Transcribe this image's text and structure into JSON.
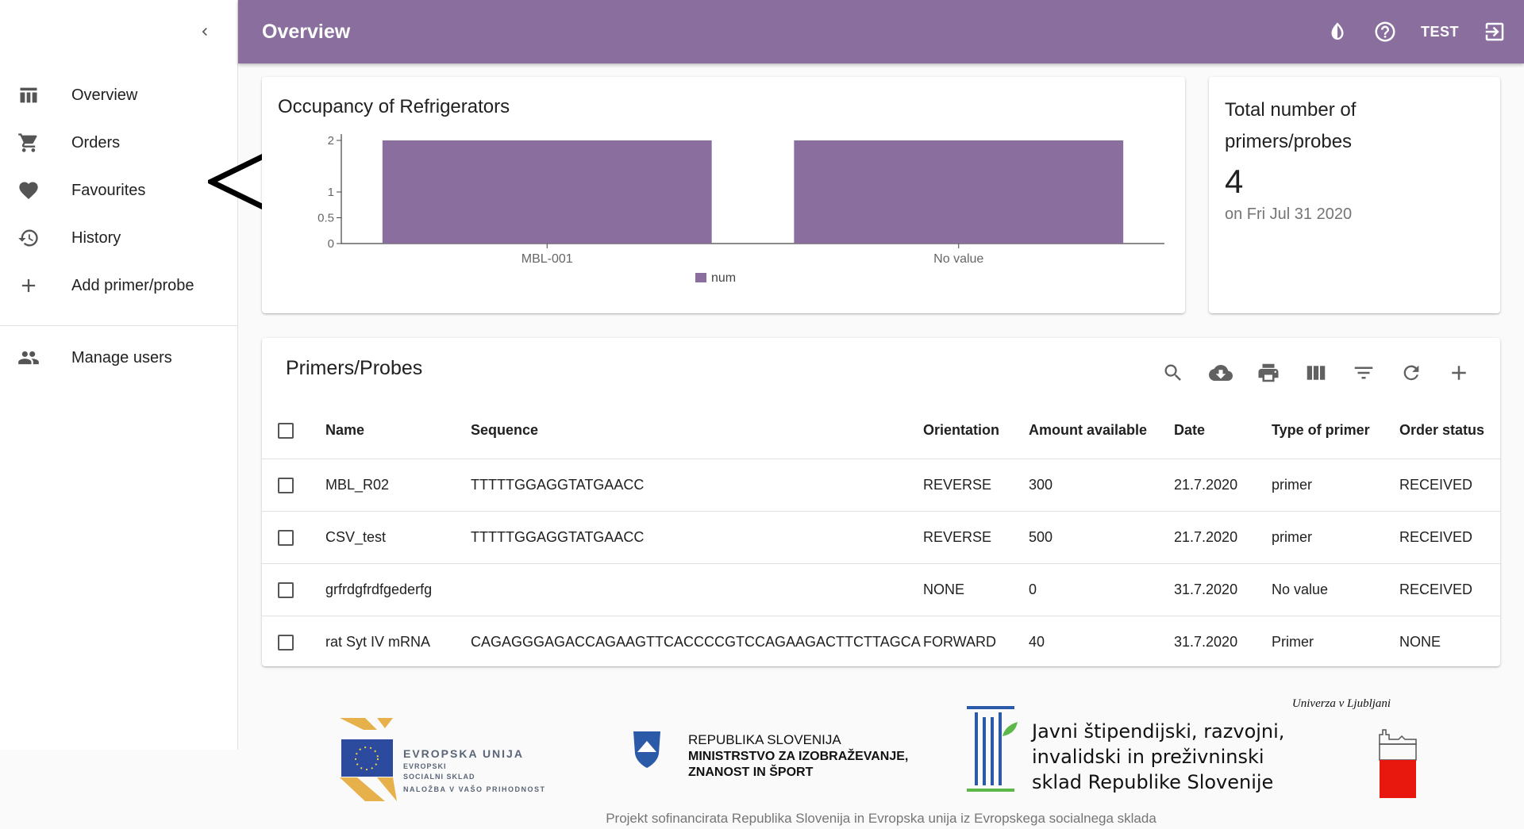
{
  "sidebar": {
    "items": [
      {
        "label": "Overview",
        "icon": "table-icon"
      },
      {
        "label": "Orders",
        "icon": "cart-icon"
      },
      {
        "label": "Favourites",
        "icon": "heart-icon"
      },
      {
        "label": "History",
        "icon": "history-icon"
      },
      {
        "label": "Add primer/probe",
        "icon": "plus-icon"
      },
      {
        "label": "Manage users",
        "icon": "users-icon"
      }
    ]
  },
  "header": {
    "title": "Overview",
    "user": "TEST",
    "color": "#8a6f9e"
  },
  "chart": {
    "title": "Occupancy of Refrigerators"
  },
  "chart_data": {
    "type": "bar",
    "categories": [
      "MBL-001",
      "No value"
    ],
    "series": [
      {
        "name": "num",
        "values": [
          2,
          2
        ],
        "color": "#8a6f9e"
      }
    ],
    "yticks": [
      "0",
      "0.5",
      "1",
      "2"
    ],
    "ylim": [
      0,
      2
    ],
    "legend": "bottom",
    "grid": false
  },
  "total": {
    "title": "Total number of primers/probes",
    "value": "4",
    "date": "on Fri Jul 31 2020"
  },
  "table": {
    "title": "Primers/Probes",
    "columns": [
      "Name",
      "Sequence",
      "Orientation",
      "Amount available",
      "Date",
      "Type of primer",
      "Order status"
    ],
    "rows": [
      [
        "MBL_R02",
        "TTTTTGGAGGTATGAACC",
        "REVERSE",
        "300",
        "21.7.2020",
        "primer",
        "RECEIVED"
      ],
      [
        "CSV_test",
        "TTTTTGGAGGTATGAACC",
        "REVERSE",
        "500",
        "21.7.2020",
        "primer",
        "RECEIVED"
      ],
      [
        "grfrdgfrdfgederfg",
        "",
        "NONE",
        "0",
        "31.7.2020",
        "No value",
        "RECEIVED"
      ],
      [
        "rat Syt IV mRNA",
        "CAGAGGGAGACCAGAAGTTCACCCCGTCCAGAAGACTTCTTAGCA",
        "FORWARD",
        "40",
        "31.7.2020",
        "Primer",
        "NONE"
      ]
    ]
  },
  "footer": {
    "eu_line1": "EVROPSKA UNIJA",
    "eu_line2": "EVROPSKI",
    "eu_line3": "SOCIALNI SKLAD",
    "eu_line4": "NALOŽBA V VAŠO PRIHODNOST",
    "rs_line1": "REPUBLIKA SLOVENIJA",
    "rs_line2": "MINISTRSTVO ZA IZOBRAŽEVANJE,",
    "rs_line3": "ZNANOST IN ŠPORT",
    "sklad_line1": "Javni štipendijski, razvojni,",
    "sklad_line2": "invalidski in preživninski",
    "sklad_line3": "sklad Republike Slovenije",
    "uni": "Univerza v Ljubljani",
    "note": "Projekt sofinancirata Republika Slovenija in Evropska unija iz Evropskega socialnega sklada"
  }
}
